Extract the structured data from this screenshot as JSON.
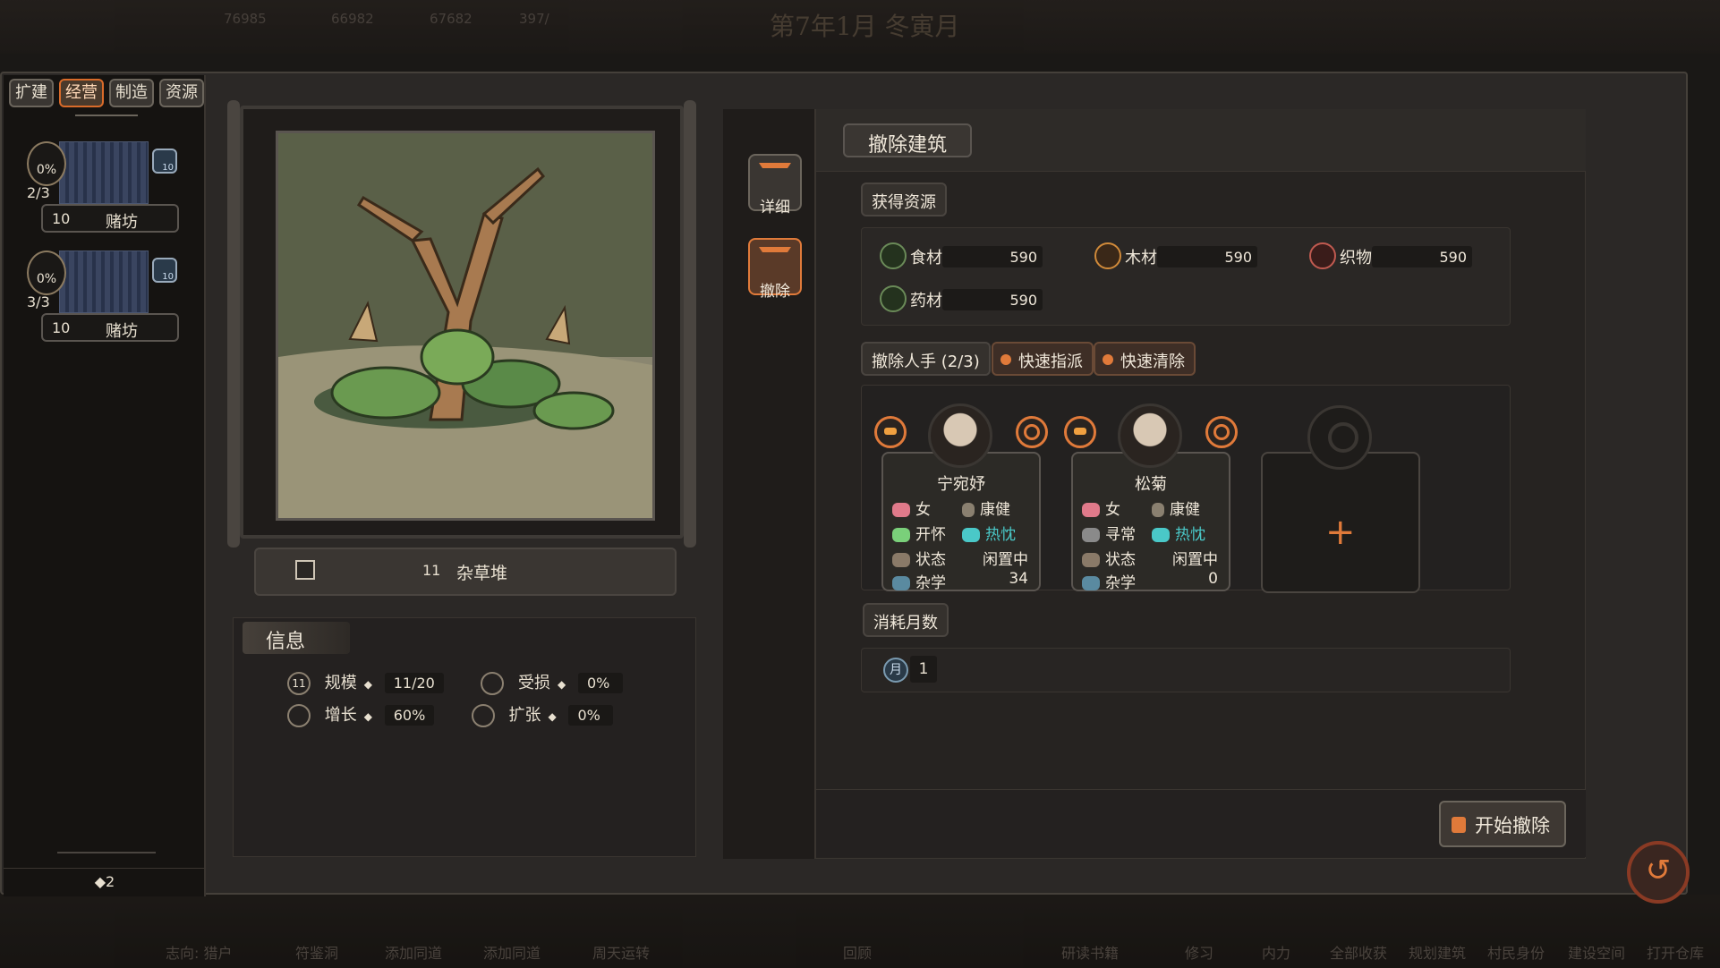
{
  "background": {
    "date": "第7年1月  冬寅月",
    "top_resources": [
      "76985",
      "66982",
      "67682",
      "397/"
    ],
    "bottom_labels": [
      "志向: 猎户",
      "符鉴洞",
      "添加同道",
      "添加同道",
      "周天运转",
      "回顾",
      "研读书籍",
      "修习",
      "内力",
      "全部收获",
      "规划建筑",
      "村民身份",
      "建设空间",
      "打开仓库"
    ]
  },
  "sidebar": {
    "tabs": [
      {
        "label": "扩建",
        "active": false
      },
      {
        "label": "经营",
        "active": true
      },
      {
        "label": "制造",
        "active": false
      },
      {
        "label": "资源",
        "active": false
      }
    ],
    "buildings": [
      {
        "percent": "0%",
        "count": "2/3",
        "level": "10",
        "name": "赌坊",
        "badge": "10"
      },
      {
        "percent": "0%",
        "count": "3/3",
        "level": "10",
        "name": "赌坊",
        "badge": "10"
      }
    ],
    "footer": "◆2"
  },
  "picture": {
    "level": "11",
    "name": "杂草堆"
  },
  "info": {
    "title": "信息",
    "rows": [
      {
        "icon": "11",
        "label": "规模",
        "value": "11/20",
        "icon2": "受损-icon",
        "label2": "受损",
        "value2": "0%"
      },
      {
        "icon": "增长-icon",
        "label": "增长",
        "value": "60%",
        "icon2": "扩张-icon",
        "label2": "扩张",
        "value2": "0%"
      }
    ]
  },
  "vertical_tabs": [
    {
      "label": "详细",
      "active": false
    },
    {
      "label": "撤除",
      "active": true
    }
  ],
  "demolish": {
    "title": "撤除建筑",
    "gain_label": "获得资源",
    "resources": [
      {
        "name": "食材",
        "value": "590",
        "color": "#6a9a58"
      },
      {
        "name": "木材",
        "value": "590",
        "color": "#d08a3a"
      },
      {
        "name": "织物",
        "value": "590",
        "color": "#c05a50"
      },
      {
        "name": "药材",
        "value": "590",
        "color": "#5a9a58"
      }
    ],
    "workers_label": "撤除人手 (2/3)",
    "quick_assign": "快速指派",
    "quick_clear": "快速清除",
    "workers": [
      {
        "name": "宁宛妤",
        "gender": "女",
        "health": "康健",
        "mood": "开怀",
        "trait": "热忱",
        "status_label": "状态",
        "status": "闲置中",
        "skill_label": "杂学",
        "skill": "34"
      },
      {
        "name": "松菊",
        "gender": "女",
        "health": "康健",
        "mood": "寻常",
        "trait": "热忱",
        "status_label": "状态",
        "status": "闲置中",
        "skill_label": "杂学",
        "skill": "0"
      }
    ],
    "add_slot": "+",
    "months_label": "消耗月数",
    "month_icon": "月",
    "months": "1",
    "start_button": "开始撤除"
  },
  "return_button": "↺"
}
